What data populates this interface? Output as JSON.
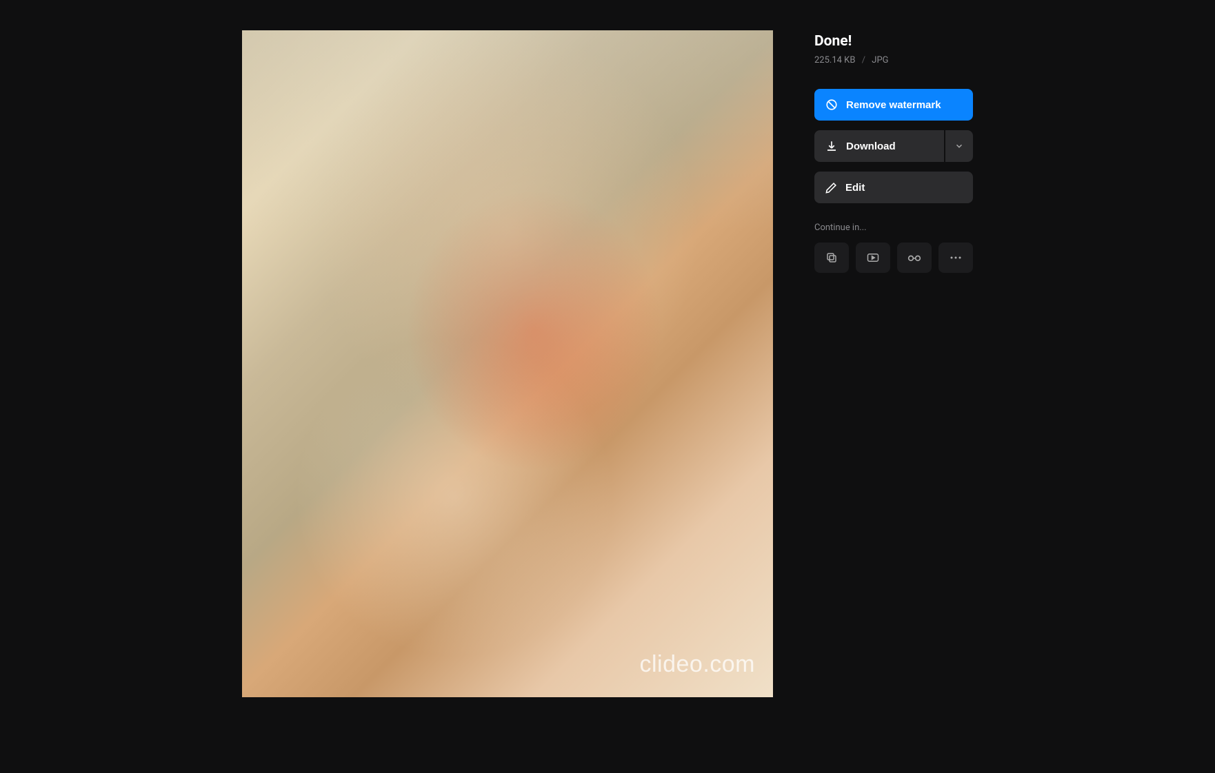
{
  "sidebar": {
    "title": "Done!",
    "file_size": "225.14 KB",
    "file_format": "JPG",
    "remove_watermark_label": "Remove watermark",
    "download_label": "Download",
    "edit_label": "Edit",
    "continue_label": "Continue in..."
  },
  "preview": {
    "watermark_text": "clideo.com"
  },
  "icons": {
    "continue_1": "layers-icon",
    "continue_2": "video-icon",
    "continue_3": "glasses-icon",
    "continue_4": "more-icon"
  }
}
